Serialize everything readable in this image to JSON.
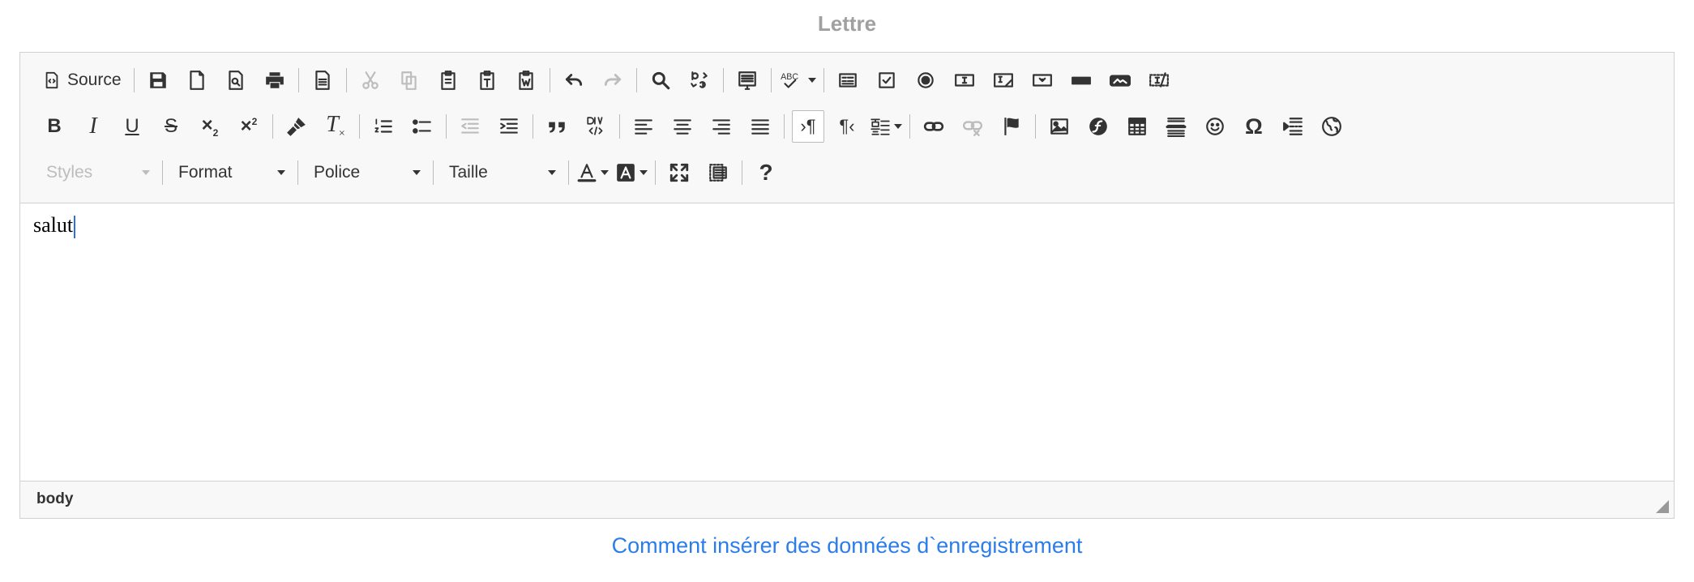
{
  "page": {
    "title": "Lettre",
    "help_link": "Comment insérer des données d`enregistrement"
  },
  "toolbar": {
    "source_label": "Source",
    "styles_placeholder": "Styles",
    "format_label": "Format",
    "font_label": "Police",
    "size_label": "Taille",
    "spell_label": "ABC",
    "help_label": "?"
  },
  "content": {
    "text": "salut"
  },
  "statusbar": {
    "path": "body"
  },
  "colors": {
    "link": "#2b7de9",
    "title": "#a0a0a0",
    "caret": "#2f6fdb"
  }
}
